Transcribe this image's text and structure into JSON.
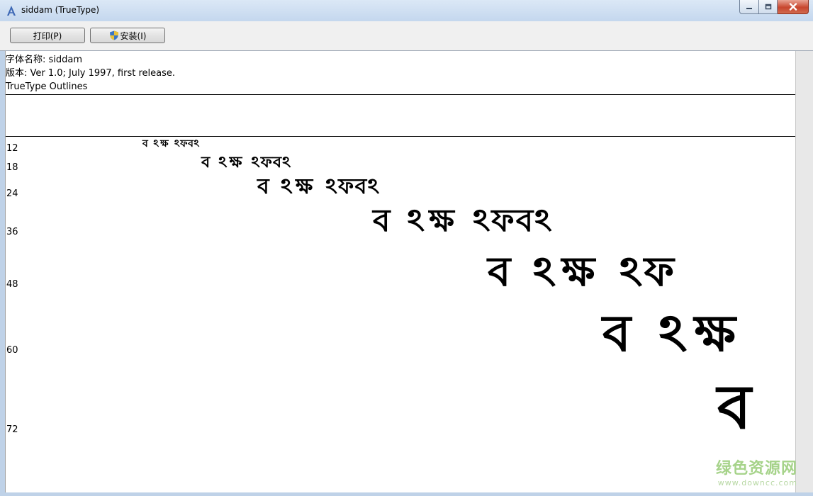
{
  "window": {
    "title": "siddam (TrueType)",
    "accent": "#c8462f"
  },
  "toolbar": {
    "print_label": "打印(P)",
    "install_label": "安装(I)"
  },
  "font_info": {
    "name_line": "字体名称: siddam",
    "version_line": "版本: Ver 1.0; July 1997, first release.",
    "outline_line": "TrueType Outlines"
  },
  "samples": [
    {
      "size": "12",
      "glyphs": [
        "ব",
        "ঽ",
        "ক্ষ",
        "ঽ",
        "ফ",
        "ব",
        "ঽ"
      ]
    },
    {
      "size": "18",
      "glyphs": [
        "ব",
        "ঽ",
        "ক্ষ",
        "ঽ",
        "ফ",
        "ব",
        "ঽ"
      ]
    },
    {
      "size": "24",
      "glyphs": [
        "ব",
        "ঽ",
        "ক্ষ",
        "ঽ",
        "ফ",
        "ব",
        "ঽ"
      ]
    },
    {
      "size": "36",
      "glyphs": [
        "ব",
        "ঽ",
        "ক্ষ",
        "ঽ",
        "ফ",
        "ব",
        "ঽ"
      ]
    },
    {
      "size": "48",
      "glyphs": [
        "ব",
        "ঽ",
        "ক্ষ",
        "ঽ",
        "ফ"
      ]
    },
    {
      "size": "60",
      "glyphs": [
        "ব",
        "ঽ",
        "ক্ষ"
      ]
    },
    {
      "size": "72",
      "glyphs": [
        "ব"
      ]
    }
  ],
  "watermark": {
    "main": "绿色资源网",
    "sub": "www.downcc.com"
  },
  "icons": {
    "app": "font-icon",
    "install": "uac-shield-icon",
    "minimize": "minimize-icon",
    "maximize": "maximize-icon",
    "close": "close-icon"
  }
}
